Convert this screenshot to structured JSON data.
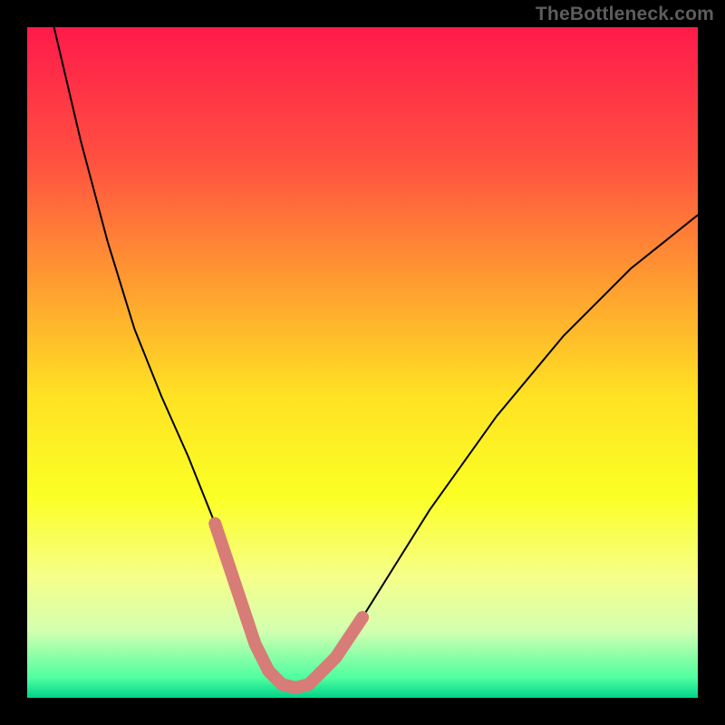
{
  "watermark": {
    "text": "TheBottleneck.com"
  },
  "chart_data": {
    "type": "line",
    "title": "",
    "xlabel": "",
    "ylabel": "",
    "xlim": [
      0,
      100
    ],
    "ylim": [
      0,
      100
    ],
    "grid": false,
    "legend": false,
    "background": {
      "gradient": [
        {
          "pos": 0.0,
          "color": "#ff1a4b"
        },
        {
          "pos": 0.2,
          "color": "#ff5140"
        },
        {
          "pos": 0.4,
          "color": "#ffa42f"
        },
        {
          "pos": 0.55,
          "color": "#ffe223"
        },
        {
          "pos": 0.7,
          "color": "#fbff25"
        },
        {
          "pos": 0.82,
          "color": "#f6ff8a"
        },
        {
          "pos": 0.9,
          "color": "#d3ffb0"
        },
        {
          "pos": 0.97,
          "color": "#4fffa0"
        },
        {
          "pos": 1.0,
          "color": "#00d48a"
        }
      ]
    },
    "series": [
      {
        "name": "bottleneck-curve",
        "color": "#000000",
        "x": [
          4,
          8,
          12,
          16,
          20,
          24,
          28,
          30,
          32,
          34,
          36,
          38,
          40,
          42,
          46,
          50,
          55,
          60,
          65,
          70,
          75,
          80,
          85,
          90,
          95,
          100
        ],
        "y": [
          100,
          83,
          68,
          55,
          45,
          36,
          26,
          20,
          14,
          8,
          4,
          2,
          1.5,
          2,
          6,
          12,
          20,
          28,
          35,
          42,
          48,
          54,
          59,
          64,
          68,
          72
        ]
      }
    ],
    "highlight_segments": [
      {
        "name": "left-dip-highlight",
        "color": "#d77c77",
        "x": [
          28,
          30,
          32,
          34,
          36
        ],
        "y": [
          26,
          20,
          14,
          8,
          4
        ]
      },
      {
        "name": "valley-floor-highlight",
        "color": "#d77c77",
        "x": [
          36,
          38,
          40,
          42
        ],
        "y": [
          4,
          2,
          1.5,
          2
        ]
      },
      {
        "name": "right-dip-highlight",
        "color": "#d77c77",
        "x": [
          42,
          46,
          50
        ],
        "y": [
          2,
          6,
          12
        ]
      }
    ]
  }
}
